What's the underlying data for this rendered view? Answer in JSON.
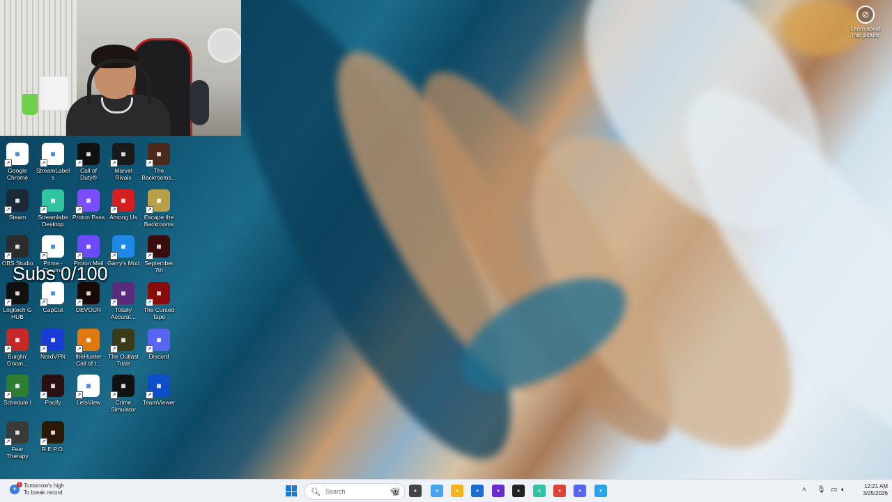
{
  "desktop": {
    "overlay_text": "Subs 0/100",
    "learn_label": "Learn about this picture",
    "icons": [
      {
        "label": "Google Chrome",
        "icon": "chrome-icon",
        "color": "#ffffff"
      },
      {
        "label": "StreamLabels",
        "icon": "streamlabels-icon",
        "color": "#ffffff"
      },
      {
        "label": "Call of Duty®",
        "icon": "call-of-duty-icon",
        "color": "#111111"
      },
      {
        "label": "Marvel Rivals",
        "icon": "marvel-rivals-icon",
        "color": "#1a1a1a"
      },
      {
        "label": "The Backrooms...",
        "icon": "backrooms-icon",
        "color": "#4a2a1a"
      },
      {
        "label": "Steam",
        "icon": "steam-icon",
        "color": "#1b2838"
      },
      {
        "label": "Streamlabs Desktop",
        "icon": "streamlabs-desktop-icon",
        "color": "#31c3a2"
      },
      {
        "label": "Proton Pass",
        "icon": "proton-pass-icon",
        "color": "#7a4dff"
      },
      {
        "label": "Among Us",
        "icon": "among-us-icon",
        "color": "#d71e1e"
      },
      {
        "label": "Escape the Backrooms",
        "icon": "escape-backrooms-icon",
        "color": "#b8a04a"
      },
      {
        "label": "OBS Studio",
        "icon": "obs-icon",
        "color": "#2c2c2c"
      },
      {
        "label": "Prime - Chrome",
        "icon": "prime-chrome-icon",
        "color": "#ffffff"
      },
      {
        "label": "Proton Mail",
        "icon": "proton-mail-icon",
        "color": "#6d4aff"
      },
      {
        "label": "Garry's Mod",
        "icon": "garrys-mod-icon",
        "color": "#1e88e5"
      },
      {
        "label": "September 7th",
        "icon": "september-7th-icon",
        "color": "#3a0d0d"
      },
      {
        "label": "Logitech G HUB",
        "icon": "logitech-ghub-icon",
        "color": "#111111"
      },
      {
        "label": "CapCut",
        "icon": "capcut-icon",
        "color": "#ffffff"
      },
      {
        "label": "DEVOUR",
        "icon": "devour-icon",
        "color": "#1a0a05"
      },
      {
        "label": "Totally Accurat...",
        "icon": "totally-accurate-icon",
        "color": "#5b2a7a"
      },
      {
        "label": "The Cursed Tape",
        "icon": "cursed-tape-icon",
        "color": "#8a0b0b"
      },
      {
        "label": "Burglin' Gnom...",
        "icon": "burglin-gnomes-icon",
        "color": "#c62828"
      },
      {
        "label": "NordVPN",
        "icon": "nordvpn-icon",
        "color": "#1a3bd6"
      },
      {
        "label": "theHunter Call of t...",
        "icon": "thehunter-icon",
        "color": "#e07a10"
      },
      {
        "label": "The Outlast Trials",
        "icon": "outlast-trials-icon",
        "color": "#3b3b1a"
      },
      {
        "label": "Discord",
        "icon": "discord-icon",
        "color": "#5865f2"
      },
      {
        "label": "Schedule I",
        "icon": "schedule-one-icon",
        "color": "#2e7d32"
      },
      {
        "label": "Pacify",
        "icon": "pacify-icon",
        "color": "#2a1010"
      },
      {
        "label": "LetsView",
        "icon": "letsview-icon",
        "color": "#ffffff"
      },
      {
        "label": "Crime Simulator",
        "icon": "crime-simulator-icon",
        "color": "#111111"
      },
      {
        "label": "TeamViewer",
        "icon": "teamviewer-icon",
        "color": "#0e4ec9"
      },
      {
        "label": "Fear Therapy",
        "icon": "fear-therapy-icon",
        "color": "#3a3a3a"
      },
      {
        "label": "R.E.P.O.",
        "icon": "repo-icon",
        "color": "#2a1a05"
      }
    ]
  },
  "taskbar": {
    "weather_title": "Tomorrow's high",
    "weather_subtitle": "To break record",
    "weather_badge": "1",
    "search_placeholder": "Search",
    "apps": [
      {
        "icon": "task-view-icon",
        "color": "#444444"
      },
      {
        "icon": "copilot-icon",
        "color": "#4aa3f0"
      },
      {
        "icon": "file-explorer-icon",
        "color": "#f2b31d"
      },
      {
        "icon": "microsoft-store-icon",
        "color": "#1b6fd1"
      },
      {
        "icon": "game-app-icon",
        "color": "#6a2bd1"
      },
      {
        "icon": "terminal-icon",
        "color": "#222222"
      },
      {
        "icon": "streamlabs-icon",
        "color": "#31c3a2"
      },
      {
        "icon": "chrome-icon",
        "color": "#db4437"
      },
      {
        "icon": "discord-icon",
        "color": "#5865f2"
      },
      {
        "icon": "letsview-icon",
        "color": "#2aa3e8"
      }
    ],
    "time": "12:21 AM",
    "date": "3/25/2026"
  }
}
